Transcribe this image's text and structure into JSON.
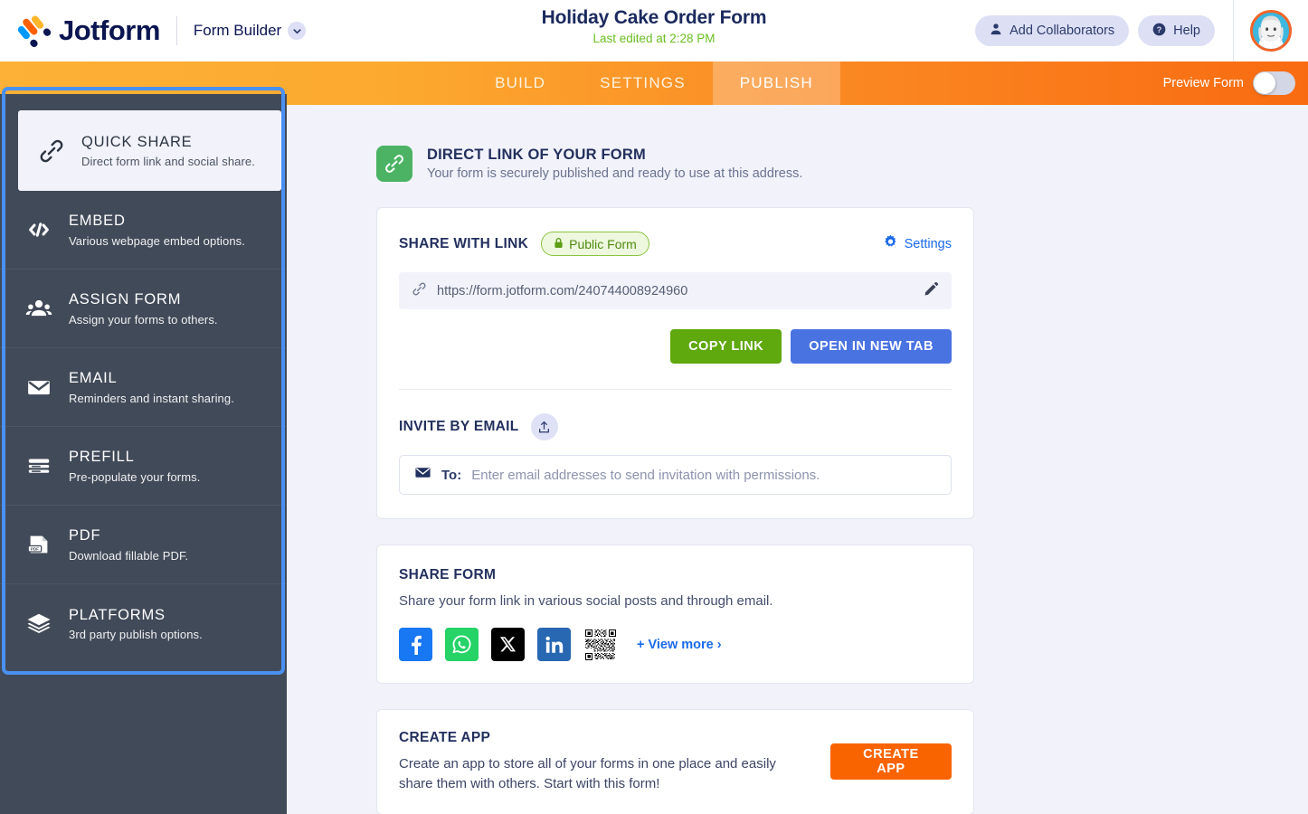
{
  "header": {
    "brand": "Jotform",
    "product": "Form Builder",
    "form_title": "Holiday Cake Order Form",
    "last_edited": "Last edited at 2:28 PM",
    "add_collaborators": "Add Collaborators",
    "help": "Help"
  },
  "nav": {
    "tabs": [
      {
        "label": "BUILD",
        "active": false
      },
      {
        "label": "SETTINGS",
        "active": false
      },
      {
        "label": "PUBLISH",
        "active": true
      }
    ],
    "preview_label": "Preview Form",
    "preview_on": false
  },
  "sidebar": {
    "items": [
      {
        "title": "QUICK SHARE",
        "sub": "Direct form link and social share.",
        "icon": "link-icon",
        "active": true
      },
      {
        "title": "EMBED",
        "sub": "Various webpage embed options.",
        "icon": "code-icon",
        "active": false
      },
      {
        "title": "ASSIGN FORM",
        "sub": "Assign your forms to others.",
        "icon": "people-icon",
        "active": false
      },
      {
        "title": "EMAIL",
        "sub": "Reminders and instant sharing.",
        "icon": "envelope-icon",
        "active": false
      },
      {
        "title": "PREFILL",
        "sub": "Pre-populate your forms.",
        "icon": "list-icon",
        "active": false
      },
      {
        "title": "PDF",
        "sub": "Download fillable PDF.",
        "icon": "pdf-icon",
        "active": false
      },
      {
        "title": "PLATFORMS",
        "sub": "3rd party publish options.",
        "icon": "layers-icon",
        "active": false
      }
    ]
  },
  "main": {
    "section": {
      "title": "DIRECT LINK OF YOUR FORM",
      "subtitle": "Your form is securely published and ready to use at this address."
    },
    "share_link": {
      "label": "SHARE WITH LINK",
      "badge": "Public Form",
      "settings": "Settings",
      "url": "https://form.jotform.com/240744008924960",
      "copy_link": "COPY LINK",
      "open_new_tab": "OPEN IN NEW TAB"
    },
    "invite": {
      "label": "INVITE BY EMAIL",
      "to_label": "To:",
      "placeholder": "Enter email addresses to send invitation with permissions."
    },
    "share_form": {
      "title": "SHARE FORM",
      "desc": "Share your form link in various social posts and through email.",
      "socials": [
        {
          "name": "facebook-icon",
          "color": "#1877F2"
        },
        {
          "name": "whatsapp-icon",
          "color": "#25D366"
        },
        {
          "name": "x-twitter-icon",
          "color": "#000000"
        },
        {
          "name": "linkedin-icon",
          "color": "#2867B2"
        },
        {
          "name": "qr-code-icon",
          "color": "#000000"
        }
      ],
      "view_more": "View more"
    },
    "create_app": {
      "title": "CREATE APP",
      "desc": "Create an app to store all of your forms in one place and easily share them with others. Start with this form!",
      "button": "CREATE APP"
    }
  },
  "colors": {
    "nav_start": "#FDB137",
    "nav_end": "#F96B11",
    "sidebar_bg": "#414A58",
    "highlight": "#4A90F2",
    "green_btn": "#5FA80D",
    "blue_btn": "#4A73E2",
    "orange_btn": "#FA6400",
    "link_blue": "#1A6AE8",
    "green_text": "#6BBF20"
  }
}
